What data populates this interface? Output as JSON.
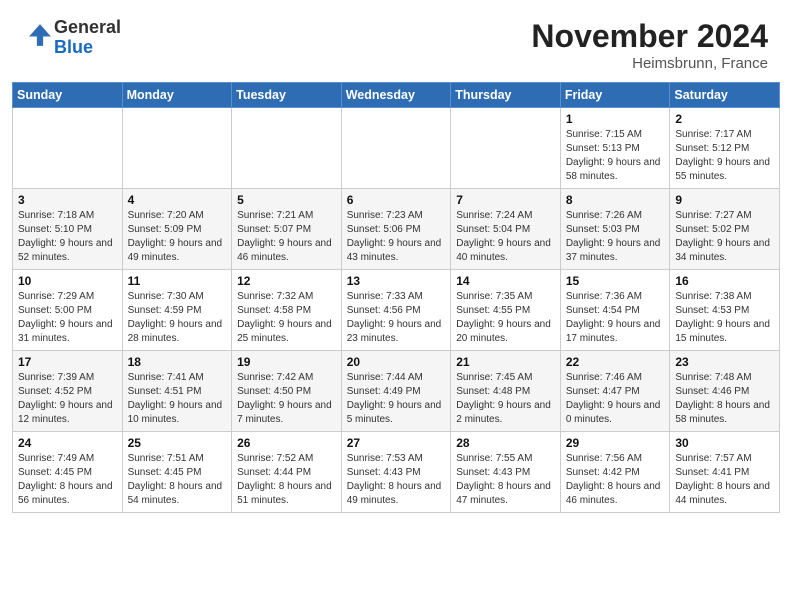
{
  "header": {
    "logo_general": "General",
    "logo_blue": "Blue",
    "title": "November 2024",
    "location": "Heimsbrunn, France"
  },
  "weekdays": [
    "Sunday",
    "Monday",
    "Tuesday",
    "Wednesday",
    "Thursday",
    "Friday",
    "Saturday"
  ],
  "weeks": [
    [
      {
        "day": "",
        "info": ""
      },
      {
        "day": "",
        "info": ""
      },
      {
        "day": "",
        "info": ""
      },
      {
        "day": "",
        "info": ""
      },
      {
        "day": "",
        "info": ""
      },
      {
        "day": "1",
        "info": "Sunrise: 7:15 AM\nSunset: 5:13 PM\nDaylight: 9 hours and 58 minutes."
      },
      {
        "day": "2",
        "info": "Sunrise: 7:17 AM\nSunset: 5:12 PM\nDaylight: 9 hours and 55 minutes."
      }
    ],
    [
      {
        "day": "3",
        "info": "Sunrise: 7:18 AM\nSunset: 5:10 PM\nDaylight: 9 hours and 52 minutes."
      },
      {
        "day": "4",
        "info": "Sunrise: 7:20 AM\nSunset: 5:09 PM\nDaylight: 9 hours and 49 minutes."
      },
      {
        "day": "5",
        "info": "Sunrise: 7:21 AM\nSunset: 5:07 PM\nDaylight: 9 hours and 46 minutes."
      },
      {
        "day": "6",
        "info": "Sunrise: 7:23 AM\nSunset: 5:06 PM\nDaylight: 9 hours and 43 minutes."
      },
      {
        "day": "7",
        "info": "Sunrise: 7:24 AM\nSunset: 5:04 PM\nDaylight: 9 hours and 40 minutes."
      },
      {
        "day": "8",
        "info": "Sunrise: 7:26 AM\nSunset: 5:03 PM\nDaylight: 9 hours and 37 minutes."
      },
      {
        "day": "9",
        "info": "Sunrise: 7:27 AM\nSunset: 5:02 PM\nDaylight: 9 hours and 34 minutes."
      }
    ],
    [
      {
        "day": "10",
        "info": "Sunrise: 7:29 AM\nSunset: 5:00 PM\nDaylight: 9 hours and 31 minutes."
      },
      {
        "day": "11",
        "info": "Sunrise: 7:30 AM\nSunset: 4:59 PM\nDaylight: 9 hours and 28 minutes."
      },
      {
        "day": "12",
        "info": "Sunrise: 7:32 AM\nSunset: 4:58 PM\nDaylight: 9 hours and 25 minutes."
      },
      {
        "day": "13",
        "info": "Sunrise: 7:33 AM\nSunset: 4:56 PM\nDaylight: 9 hours and 23 minutes."
      },
      {
        "day": "14",
        "info": "Sunrise: 7:35 AM\nSunset: 4:55 PM\nDaylight: 9 hours and 20 minutes."
      },
      {
        "day": "15",
        "info": "Sunrise: 7:36 AM\nSunset: 4:54 PM\nDaylight: 9 hours and 17 minutes."
      },
      {
        "day": "16",
        "info": "Sunrise: 7:38 AM\nSunset: 4:53 PM\nDaylight: 9 hours and 15 minutes."
      }
    ],
    [
      {
        "day": "17",
        "info": "Sunrise: 7:39 AM\nSunset: 4:52 PM\nDaylight: 9 hours and 12 minutes."
      },
      {
        "day": "18",
        "info": "Sunrise: 7:41 AM\nSunset: 4:51 PM\nDaylight: 9 hours and 10 minutes."
      },
      {
        "day": "19",
        "info": "Sunrise: 7:42 AM\nSunset: 4:50 PM\nDaylight: 9 hours and 7 minutes."
      },
      {
        "day": "20",
        "info": "Sunrise: 7:44 AM\nSunset: 4:49 PM\nDaylight: 9 hours and 5 minutes."
      },
      {
        "day": "21",
        "info": "Sunrise: 7:45 AM\nSunset: 4:48 PM\nDaylight: 9 hours and 2 minutes."
      },
      {
        "day": "22",
        "info": "Sunrise: 7:46 AM\nSunset: 4:47 PM\nDaylight: 9 hours and 0 minutes."
      },
      {
        "day": "23",
        "info": "Sunrise: 7:48 AM\nSunset: 4:46 PM\nDaylight: 8 hours and 58 minutes."
      }
    ],
    [
      {
        "day": "24",
        "info": "Sunrise: 7:49 AM\nSunset: 4:45 PM\nDaylight: 8 hours and 56 minutes."
      },
      {
        "day": "25",
        "info": "Sunrise: 7:51 AM\nSunset: 4:45 PM\nDaylight: 8 hours and 54 minutes."
      },
      {
        "day": "26",
        "info": "Sunrise: 7:52 AM\nSunset: 4:44 PM\nDaylight: 8 hours and 51 minutes."
      },
      {
        "day": "27",
        "info": "Sunrise: 7:53 AM\nSunset: 4:43 PM\nDaylight: 8 hours and 49 minutes."
      },
      {
        "day": "28",
        "info": "Sunrise: 7:55 AM\nSunset: 4:43 PM\nDaylight: 8 hours and 47 minutes."
      },
      {
        "day": "29",
        "info": "Sunrise: 7:56 AM\nSunset: 4:42 PM\nDaylight: 8 hours and 46 minutes."
      },
      {
        "day": "30",
        "info": "Sunrise: 7:57 AM\nSunset: 4:41 PM\nDaylight: 8 hours and 44 minutes."
      }
    ]
  ]
}
